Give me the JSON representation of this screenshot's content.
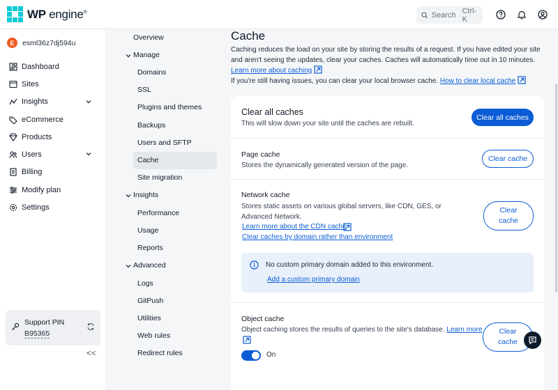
{
  "brand": {
    "name_bold": "WP",
    "name_rest": "engine",
    "trademark": "®"
  },
  "search": {
    "label": "Search",
    "shortcut": "Ctrl-K"
  },
  "account": {
    "initial": "E",
    "name": "esml36z7dj594u"
  },
  "nav": [
    {
      "label": "Dashboard",
      "icon": "dashboard-icon"
    },
    {
      "label": "Sites",
      "icon": "sites-icon"
    },
    {
      "label": "Insights",
      "icon": "insights-icon",
      "expandable": true
    },
    {
      "label": "eCommerce",
      "icon": "ecommerce-icon"
    },
    {
      "label": "Products",
      "icon": "products-icon"
    },
    {
      "label": "Users",
      "icon": "users-icon",
      "expandable": true
    },
    {
      "label": "Billing",
      "icon": "billing-icon"
    },
    {
      "label": "Modify plan",
      "icon": "modify-plan-icon"
    },
    {
      "label": "Settings",
      "icon": "settings-icon"
    }
  ],
  "support": {
    "label": "Support PIN",
    "pin": "B95365"
  },
  "collapse_label": "<<",
  "subnav": {
    "overview": "Overview",
    "manage": "Manage",
    "manage_items": [
      "Domains",
      "SSL",
      "Plugins and themes",
      "Backups",
      "Users and SFTP",
      "Cache",
      "Site migration"
    ],
    "insights": "Insights",
    "insights_items": [
      "Performance",
      "Usage",
      "Reports"
    ],
    "advanced": "Advanced",
    "advanced_items": [
      "Logs",
      "GitPush",
      "Utilities",
      "Web rules",
      "Redirect rules"
    ],
    "active": "Cache"
  },
  "page": {
    "title": "Cache",
    "intro_1": "Caching reduces the load on your site by storing the results of a request. If you have edited your site and aren't seeing the updates, clear your caches. Caches will automatically time out in 10 minutes.",
    "intro_link_1": "Learn more about caching",
    "intro_2": "If you're still having issues, you can clear your local browser cache.",
    "intro_link_2": "How to clear local cache"
  },
  "clear_all": {
    "title": "Clear all caches",
    "desc": "This will slow down your site until the caches are rebuilt.",
    "button": "Clear all caches"
  },
  "page_cache": {
    "title": "Page cache",
    "desc": "Stores the dynamically generated version of the page.",
    "button": "Clear cache"
  },
  "network_cache": {
    "title": "Network cache",
    "desc": "Stores static assets on various global servers, like CDN, GES, or Advanced Network.",
    "link_1": "Learn more about the CDN cache",
    "link_2": "Clear caches by domain rather than environment",
    "button_line1": "Clear",
    "button_line2": "cache",
    "info_msg": "No custom primary domain added to this environment.",
    "info_link": "Add a custom primary domain"
  },
  "object_cache": {
    "title": "Object cache",
    "desc": "Object caching stores the results of queries to the site's database.",
    "link": "Learn more",
    "button_line1": "Clear",
    "button_line2": "cache",
    "toggle_label": "On",
    "toggle_on": true
  },
  "colors": {
    "accent": "#0b5cd5",
    "brand": "#0ecad4",
    "avatar": "#f05a22"
  }
}
